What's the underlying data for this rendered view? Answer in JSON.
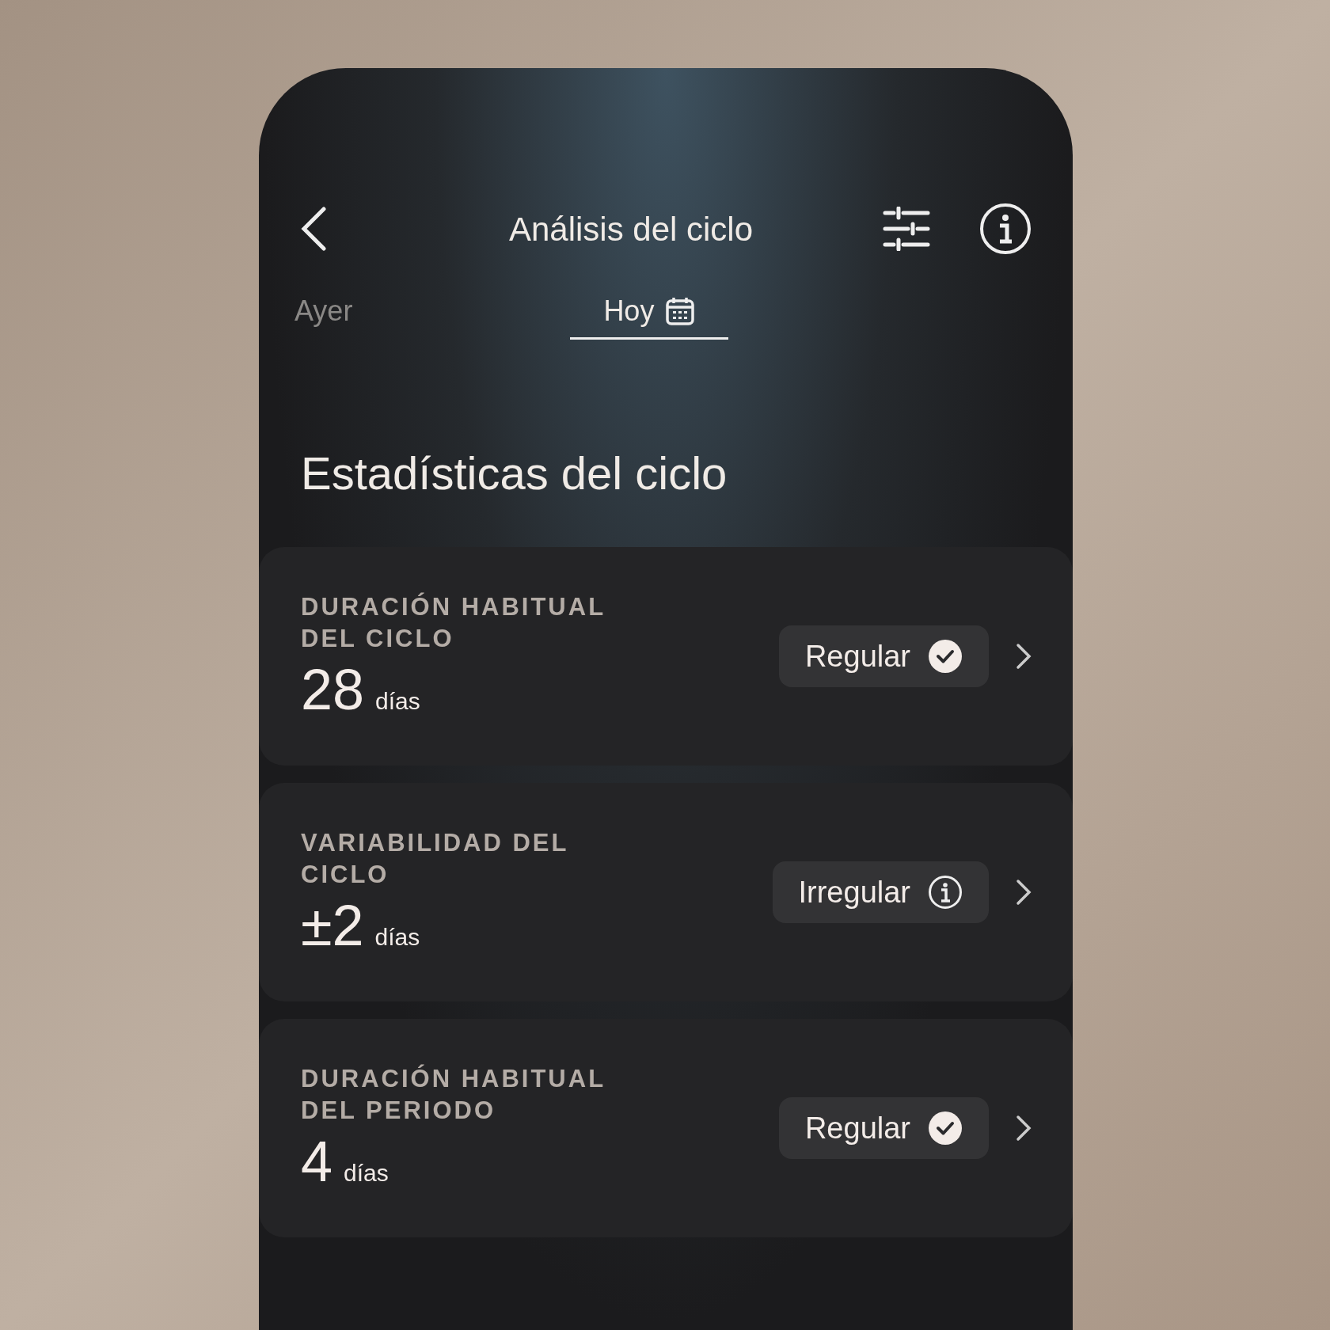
{
  "header": {
    "title": "Análisis del ciclo"
  },
  "tabs": [
    {
      "label": "Ayer",
      "selected": false
    },
    {
      "label": "Hoy",
      "selected": true
    }
  ],
  "section_title": "Estadísticas del ciclo",
  "cards": [
    {
      "label": "DURACIÓN HABITUAL DEL CICLO",
      "value": "28",
      "unit": "días",
      "badge": {
        "label": "Regular",
        "kind": "check"
      }
    },
    {
      "label": "VARIABILIDAD DEL CICLO",
      "value": "±2",
      "unit": "días",
      "badge": {
        "label": "Irregular",
        "kind": "info"
      }
    },
    {
      "label": "DURACIÓN HABITUAL DEL PERIODO",
      "value": "4",
      "unit": "días",
      "badge": {
        "label": "Regular",
        "kind": "check"
      }
    }
  ]
}
